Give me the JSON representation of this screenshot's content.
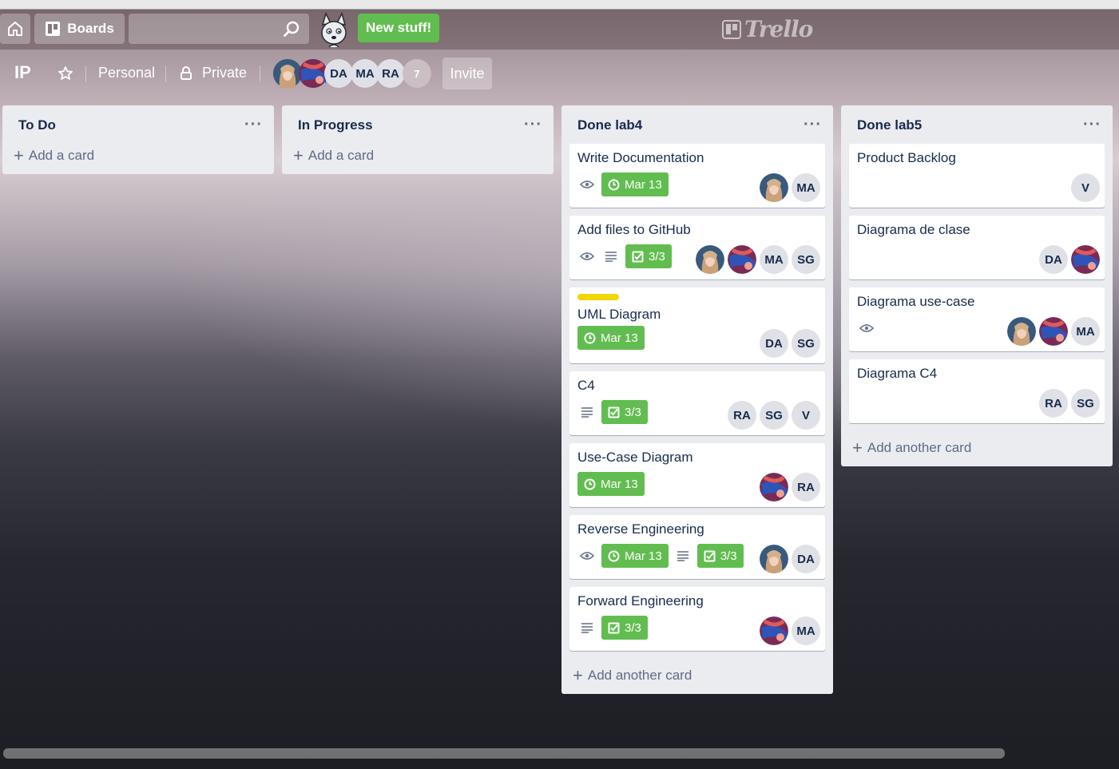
{
  "header": {
    "boards_label": "Boards",
    "search_value": "",
    "new_stuff_label": "New stuff!",
    "logo_text": "Trello"
  },
  "board": {
    "title": "IP",
    "team": "Personal",
    "visibility": "Private",
    "members": [
      "DA",
      "MA",
      "RA"
    ],
    "member_count": "7",
    "invite_label": "Invite"
  },
  "lists": [
    {
      "title": "To Do",
      "add_label": "Add a card",
      "cards": []
    },
    {
      "title": "In Progress",
      "add_label": "Add a card",
      "cards": []
    },
    {
      "title": "Done lab4",
      "add_label": "Add another card",
      "cards": [
        {
          "title": "Write Documentation",
          "due": "Mar 13",
          "members": [
            "MA"
          ]
        },
        {
          "title": "Add files to GitHub",
          "checklist": "3/3",
          "members": [
            "MA",
            "SG"
          ]
        },
        {
          "title": "UML Diagram",
          "due": "Mar 13",
          "members": [
            "DA",
            "SG"
          ]
        },
        {
          "title": "C4",
          "checklist": "3/3",
          "members": [
            "RA",
            "SG",
            "V"
          ]
        },
        {
          "title": "Use-Case Diagram",
          "due": "Mar 13",
          "members": [
            "RA"
          ]
        },
        {
          "title": "Reverse Engineering",
          "due": "Mar 13",
          "checklist": "3/3",
          "members": [
            "DA"
          ]
        },
        {
          "title": "Forward Engineering",
          "checklist": "3/3",
          "members": [
            "MA"
          ]
        }
      ]
    },
    {
      "title": "Done lab5",
      "add_label": "Add another card",
      "cards": [
        {
          "title": "Product Backlog",
          "members": [
            "V"
          ]
        },
        {
          "title": "Diagrama de clase",
          "members": [
            "DA"
          ]
        },
        {
          "title": "Diagrama use-case",
          "members": [
            "MA"
          ]
        },
        {
          "title": "Diagrama C4",
          "members": [
            "RA",
            "SG"
          ]
        }
      ]
    }
  ],
  "colors": {
    "green": "#61bd4f",
    "yellow_label": "#f2d600",
    "list_bg": "#ebecf0"
  }
}
